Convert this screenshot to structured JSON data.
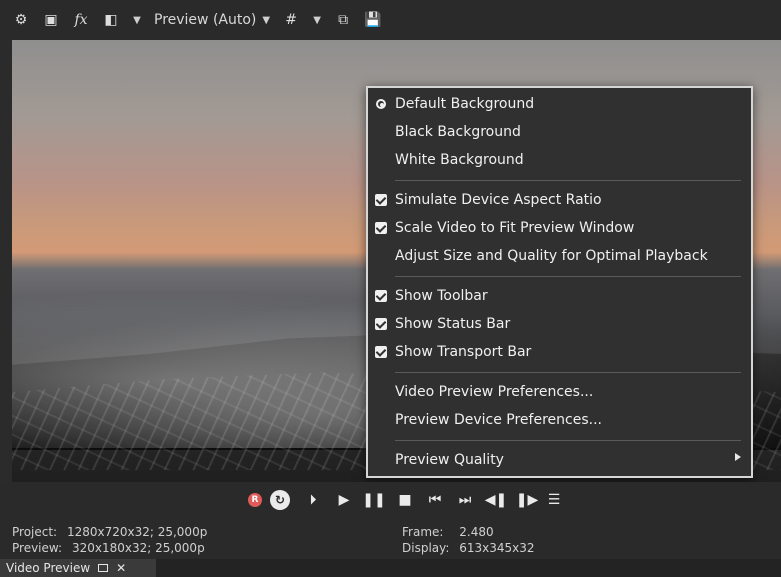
{
  "toolbar": {
    "icons": {
      "settings": "gear-icon",
      "window": "window-icon",
      "fx": "fx",
      "split": "split-screen-icon",
      "grid": "grid-icon",
      "copy": "copy-icon",
      "save": "save-icon"
    },
    "preview_mode_label": "Preview (Auto)"
  },
  "menu": {
    "items": [
      {
        "label": "Default Background"
      },
      {
        "label": "Black Background"
      },
      {
        "label": "White Background"
      },
      {
        "label": "Simulate Device Aspect Ratio"
      },
      {
        "label": "Scale Video to Fit Preview Window"
      },
      {
        "label": "Adjust Size and Quality for Optimal Playback"
      },
      {
        "label": "Show Toolbar"
      },
      {
        "label": "Show Status Bar"
      },
      {
        "label": "Show Transport Bar"
      },
      {
        "label": "Video Preview Preferences..."
      },
      {
        "label": "Preview Device Preferences..."
      },
      {
        "label": "Preview Quality"
      }
    ]
  },
  "status": {
    "project_label": "Project:",
    "project_value": "1280x720x32; 25,000p",
    "preview_label": "Preview:",
    "preview_value": "320x180x32; 25,000p",
    "frame_label": "Frame:",
    "frame_value": "2.480",
    "display_label": "Display:",
    "display_value": "613x345x32"
  },
  "bottom": {
    "tab_label": "Video Preview"
  },
  "transport": {
    "record_letter": "R"
  }
}
